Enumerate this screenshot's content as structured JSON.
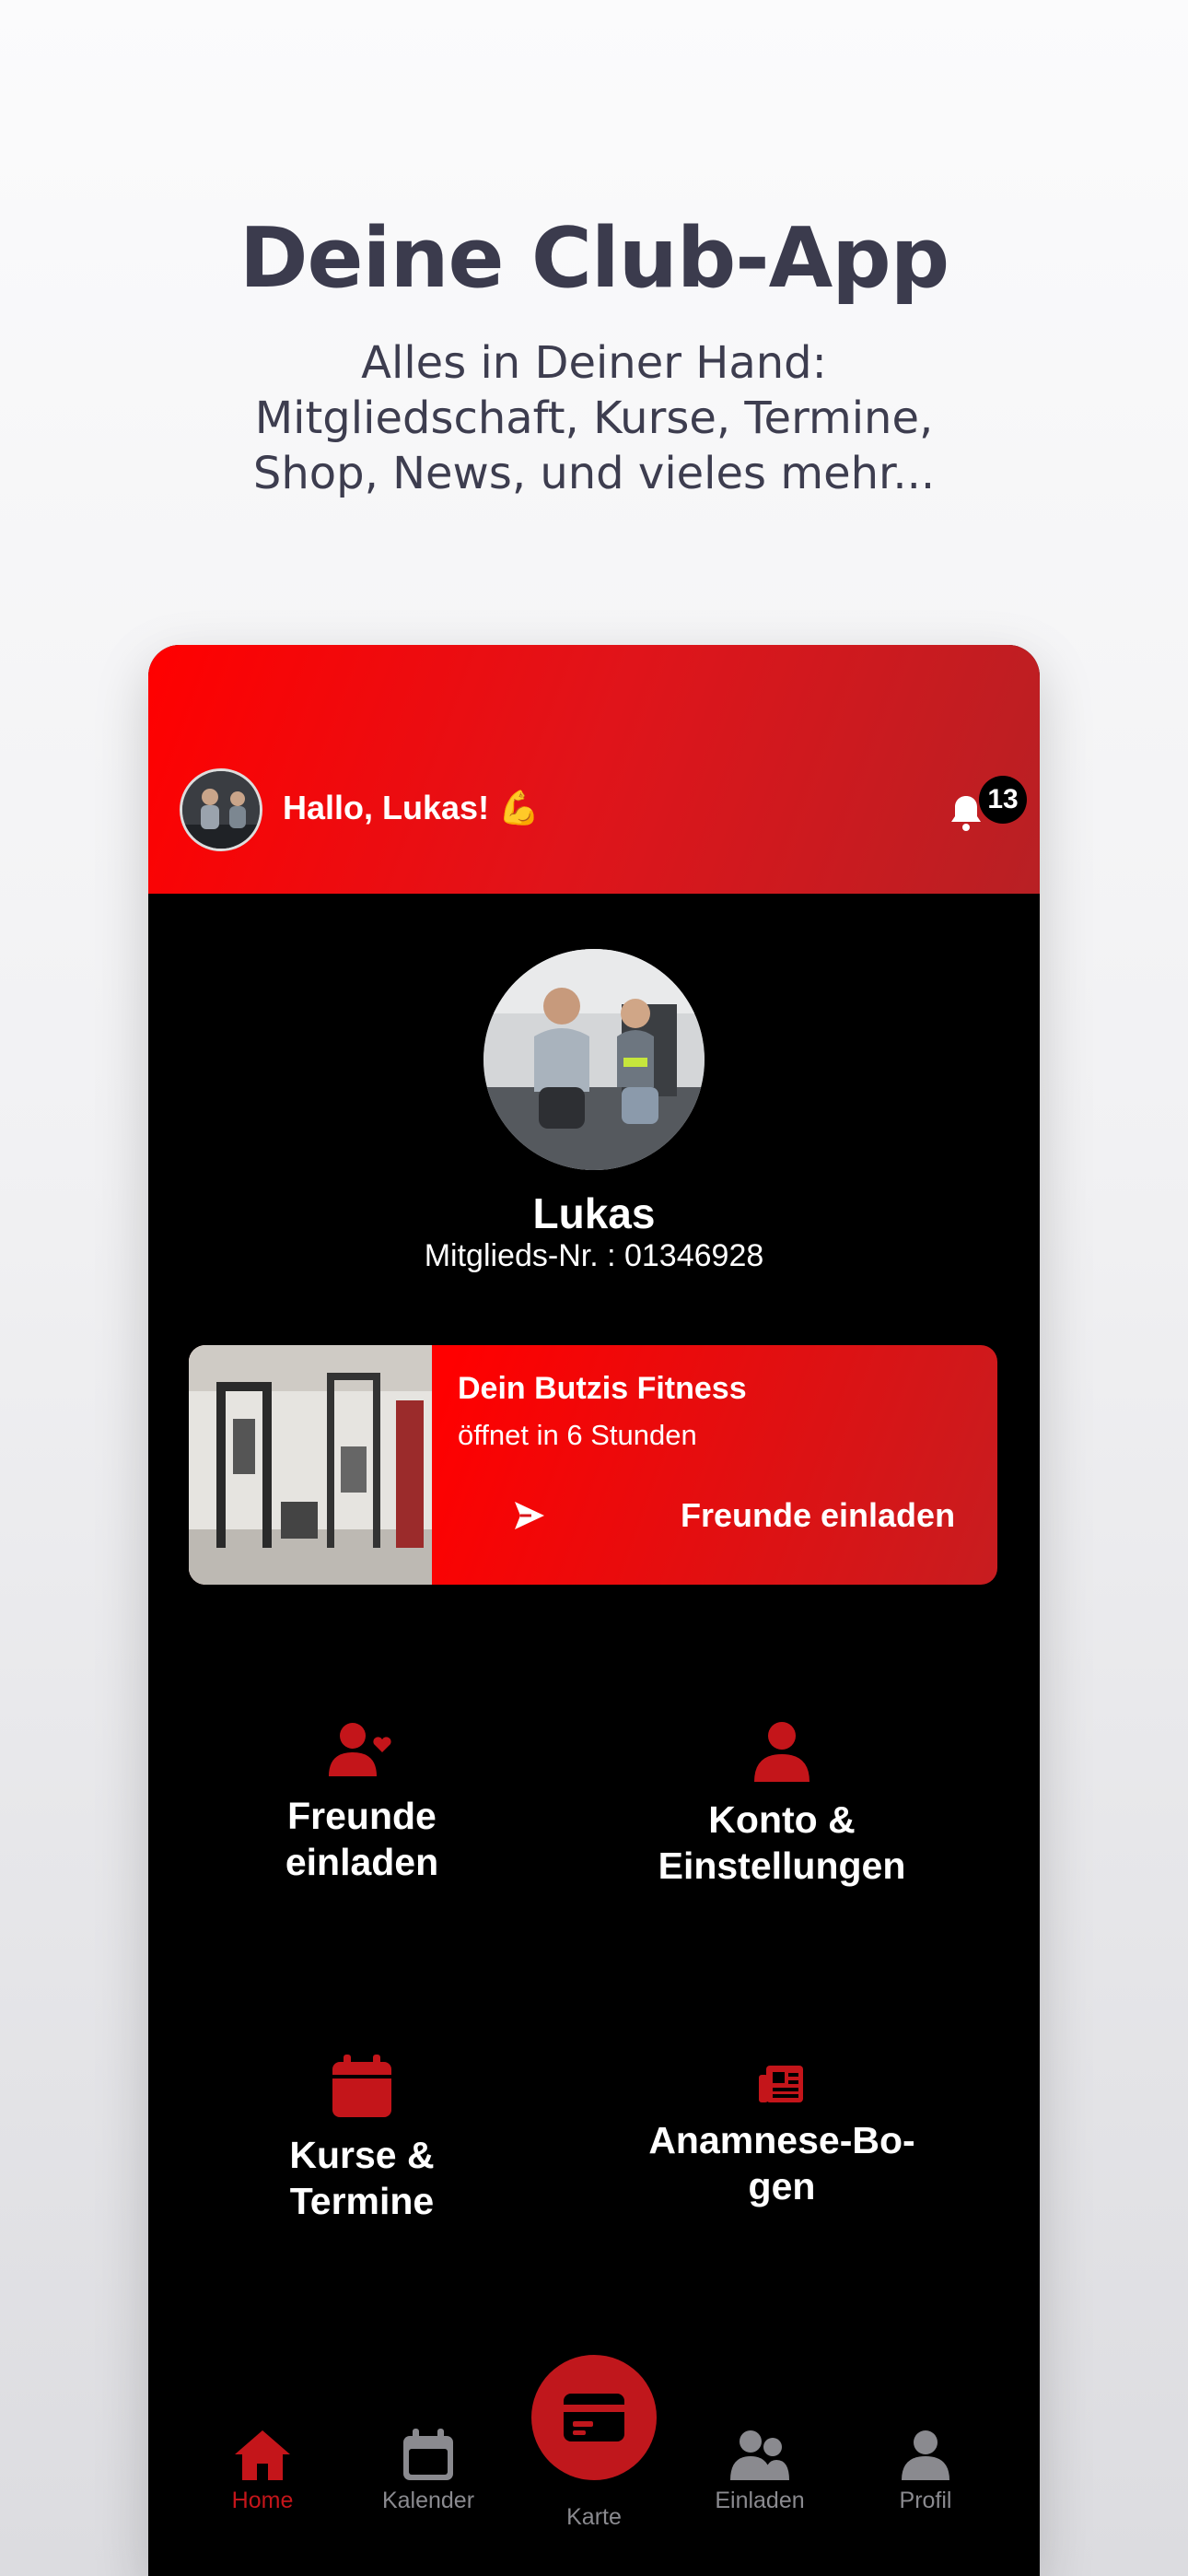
{
  "hero": {
    "title": "Deine Club-App",
    "subtitle_lines": [
      "Alles in Deiner Hand:",
      "Mitgliedschaft, Kurse, Termine,",
      "Shop, News, und vieles mehr..."
    ]
  },
  "header": {
    "greeting": "Hallo, Lukas! 💪",
    "notification_count": "13",
    "avatar_icon": "user-avatar"
  },
  "profile": {
    "name": "Lukas",
    "member_number": "Mitglieds-Nr. : 01346928"
  },
  "club_card": {
    "title": "Dein Butzis Fitness",
    "status": "öffnet in 6 Stunden",
    "invite_label": "Freunde einladen"
  },
  "tiles": [
    {
      "label_line1": "Freunde",
      "label_line2": "einladen",
      "icon": "user-heart-icon"
    },
    {
      "label_line1": "Konto &",
      "label_line2": "Einstellungen",
      "icon": "user-icon"
    },
    {
      "label_line1": "Kurse &",
      "label_line2": "Termine",
      "icon": "calendar-icon"
    },
    {
      "label_line1": "Anamnese-Bo-",
      "label_line2": "gen",
      "icon": "newspaper-icon"
    }
  ],
  "nav": {
    "items": [
      {
        "label": "Home",
        "icon": "home-icon",
        "active": true
      },
      {
        "label": "Kalender",
        "icon": "calendar-icon",
        "active": false
      },
      {
        "label": "Karte",
        "icon": "card-icon",
        "active": false
      },
      {
        "label": "Einladen",
        "icon": "users-icon",
        "active": false
      },
      {
        "label": "Profil",
        "icon": "user-icon",
        "active": false
      }
    ]
  },
  "colors": {
    "accent": "#c4151a",
    "header_red": "#ff0000",
    "background": "#000000",
    "inactive": "#8a8a8f"
  }
}
